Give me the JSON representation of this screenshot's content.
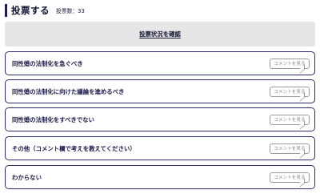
{
  "header": {
    "title": "投票する",
    "vote_count": "投票数：33"
  },
  "confirm_button": {
    "label": "投票状況を確認"
  },
  "options": [
    {
      "label": "同性婚の法制化を急ぐべき",
      "comment_label": "コメントを見る"
    },
    {
      "label": "同性婚の法制化に向けた議論を進めるべき",
      "comment_label": "コメントを見る"
    },
    {
      "label": "同性婚の法制化をすべきでない",
      "comment_label": "コメントを見る"
    },
    {
      "label": "その他（コメント欄で考えを教えてください）",
      "comment_label": "コメントを見る"
    },
    {
      "label": "わからない",
      "comment_label": "コメントを見る"
    }
  ]
}
